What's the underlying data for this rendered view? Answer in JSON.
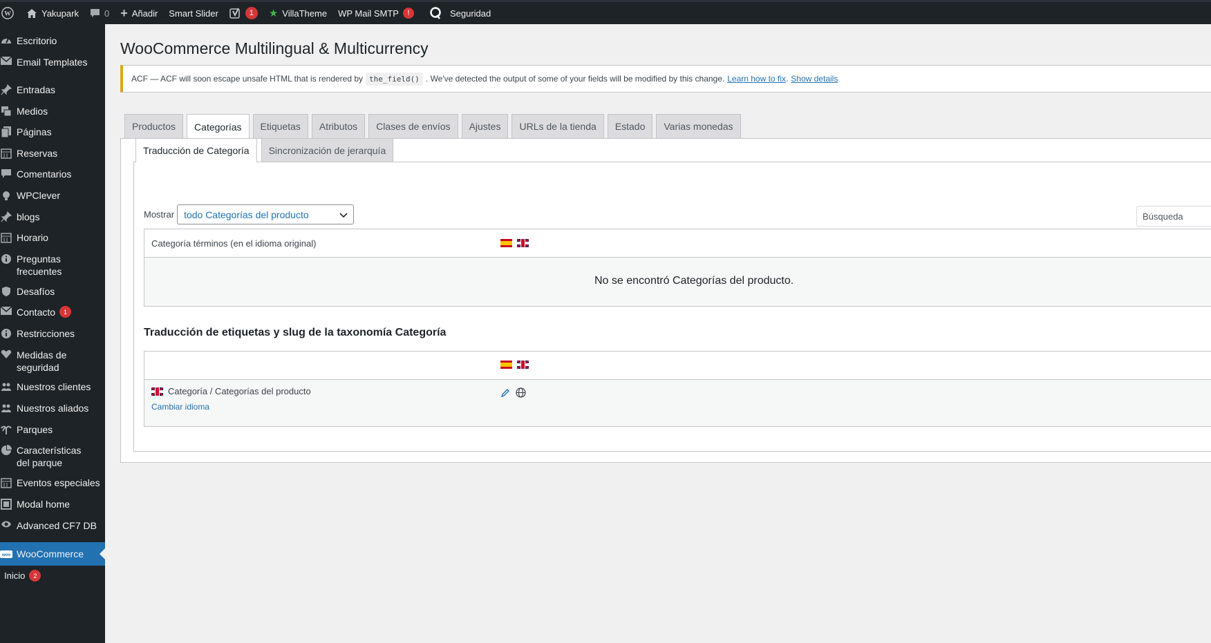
{
  "admin_bar": {
    "site_name": "Yakupark",
    "comments_count": "0",
    "add_new": "Añadir",
    "smart_slider": "Smart Slider",
    "yoast_badge": "1",
    "villatheme": "VillaTheme",
    "wp_mail_smtp": "WP Mail SMTP",
    "wp_mail_badge": "!",
    "security": "Seguridad"
  },
  "sidebar": {
    "items": [
      {
        "label": "Escritorio",
        "icon": "dashboard-icon"
      },
      {
        "label": "Email Templates",
        "icon": "email-icon"
      },
      {
        "label": "Entradas",
        "icon": "pin-icon"
      },
      {
        "label": "Medios",
        "icon": "media-icon"
      },
      {
        "label": "Páginas",
        "icon": "pages-icon"
      },
      {
        "label": "Reservas",
        "icon": "calendar-icon"
      },
      {
        "label": "Comentarios",
        "icon": "comment-icon"
      },
      {
        "label": "WPClever",
        "icon": "bulb-icon"
      },
      {
        "label": "blogs",
        "icon": "pin-icon"
      },
      {
        "label": "Horario",
        "icon": "calendar-icon"
      },
      {
        "label": "Preguntas frecuentes",
        "icon": "info-icon"
      },
      {
        "label": "Desafíos",
        "icon": "shield-icon"
      },
      {
        "label": "Contacto",
        "icon": "email-icon",
        "badge": "1"
      },
      {
        "label": "Restricciones",
        "icon": "info-icon"
      },
      {
        "label": "Medidas de seguridad",
        "icon": "heart-icon"
      },
      {
        "label": "Nuestros clientes",
        "icon": "groups-icon"
      },
      {
        "label": "Nuestros aliados",
        "icon": "groups-icon"
      },
      {
        "label": "Parques",
        "icon": "palm-icon"
      },
      {
        "label": "Características del parque",
        "icon": "chart-pie-icon"
      },
      {
        "label": "Eventos especiales",
        "icon": "calendar-icon"
      },
      {
        "label": "Modal home",
        "icon": "layout-icon"
      },
      {
        "label": "Advanced CF7 DB",
        "icon": "eye-icon"
      },
      {
        "label": "WooCommerce",
        "icon": "woo-icon",
        "active": true
      },
      {
        "label": "Inicio",
        "icon": "",
        "badge": "2"
      }
    ]
  },
  "page": {
    "title": "WooCommerce Multilingual & Multicurrency",
    "notice": {
      "prefix": "ACF — ACF will soon escape unsafe HTML that is rendered by",
      "code": "the_field()",
      "middle": ". We've detected the output of some of your fields will be modified by this change.",
      "link1": "Learn how to fix",
      "sep": ".",
      "link2": "Show details"
    },
    "tabs": [
      "Productos",
      "Categorías",
      "Etiquetas",
      "Atributos",
      "Clases de envíos",
      "Ajustes",
      "URLs de la tienda",
      "Estado",
      "Varias monedas"
    ],
    "active_tab": "Categorías",
    "subtabs": [
      "Traducción de Categoría",
      "Sincronización de jerarquía"
    ],
    "filter": {
      "label": "Mostrar",
      "selected": "todo Categorías del producto"
    },
    "search_placeholder": "Búsqueda",
    "table1": {
      "header": "Categoría términos (en el idioma original)",
      "empty_message": "No se encontró Categorías del producto."
    },
    "section_title": "Traducción de etiquetas y slug de la taxonomía Categoría",
    "table2": {
      "row_label": "Categoría / Categorías del producto",
      "row_link": "Cambiar idioma"
    }
  }
}
